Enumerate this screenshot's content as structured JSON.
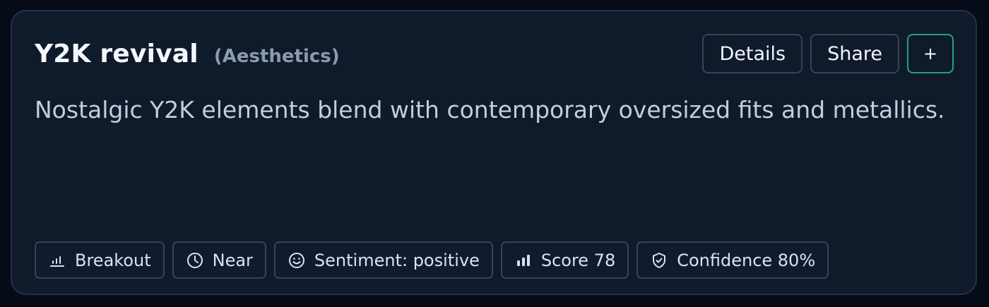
{
  "card": {
    "title": "Y2K revival",
    "category": "(Aesthetics)",
    "description": "Nostalgic Y2K elements blend with contemporary oversized fits and metallics."
  },
  "actions": {
    "details_label": "Details",
    "share_label": "Share",
    "add_label": "+"
  },
  "chips": [
    {
      "icon": "bar-chart-icon",
      "label": "Breakout"
    },
    {
      "icon": "clock-icon",
      "label": "Near"
    },
    {
      "icon": "smiley-icon",
      "label": "Sentiment: positive"
    },
    {
      "icon": "bar-chart-filled-icon",
      "label": "Score 78"
    },
    {
      "icon": "shield-check-icon",
      "label": "Confidence 80%"
    }
  ],
  "colors": {
    "page_background": "#060b18",
    "card_background": "#0f1a2b",
    "accent_green": "#23a27d",
    "border": "#374457"
  }
}
